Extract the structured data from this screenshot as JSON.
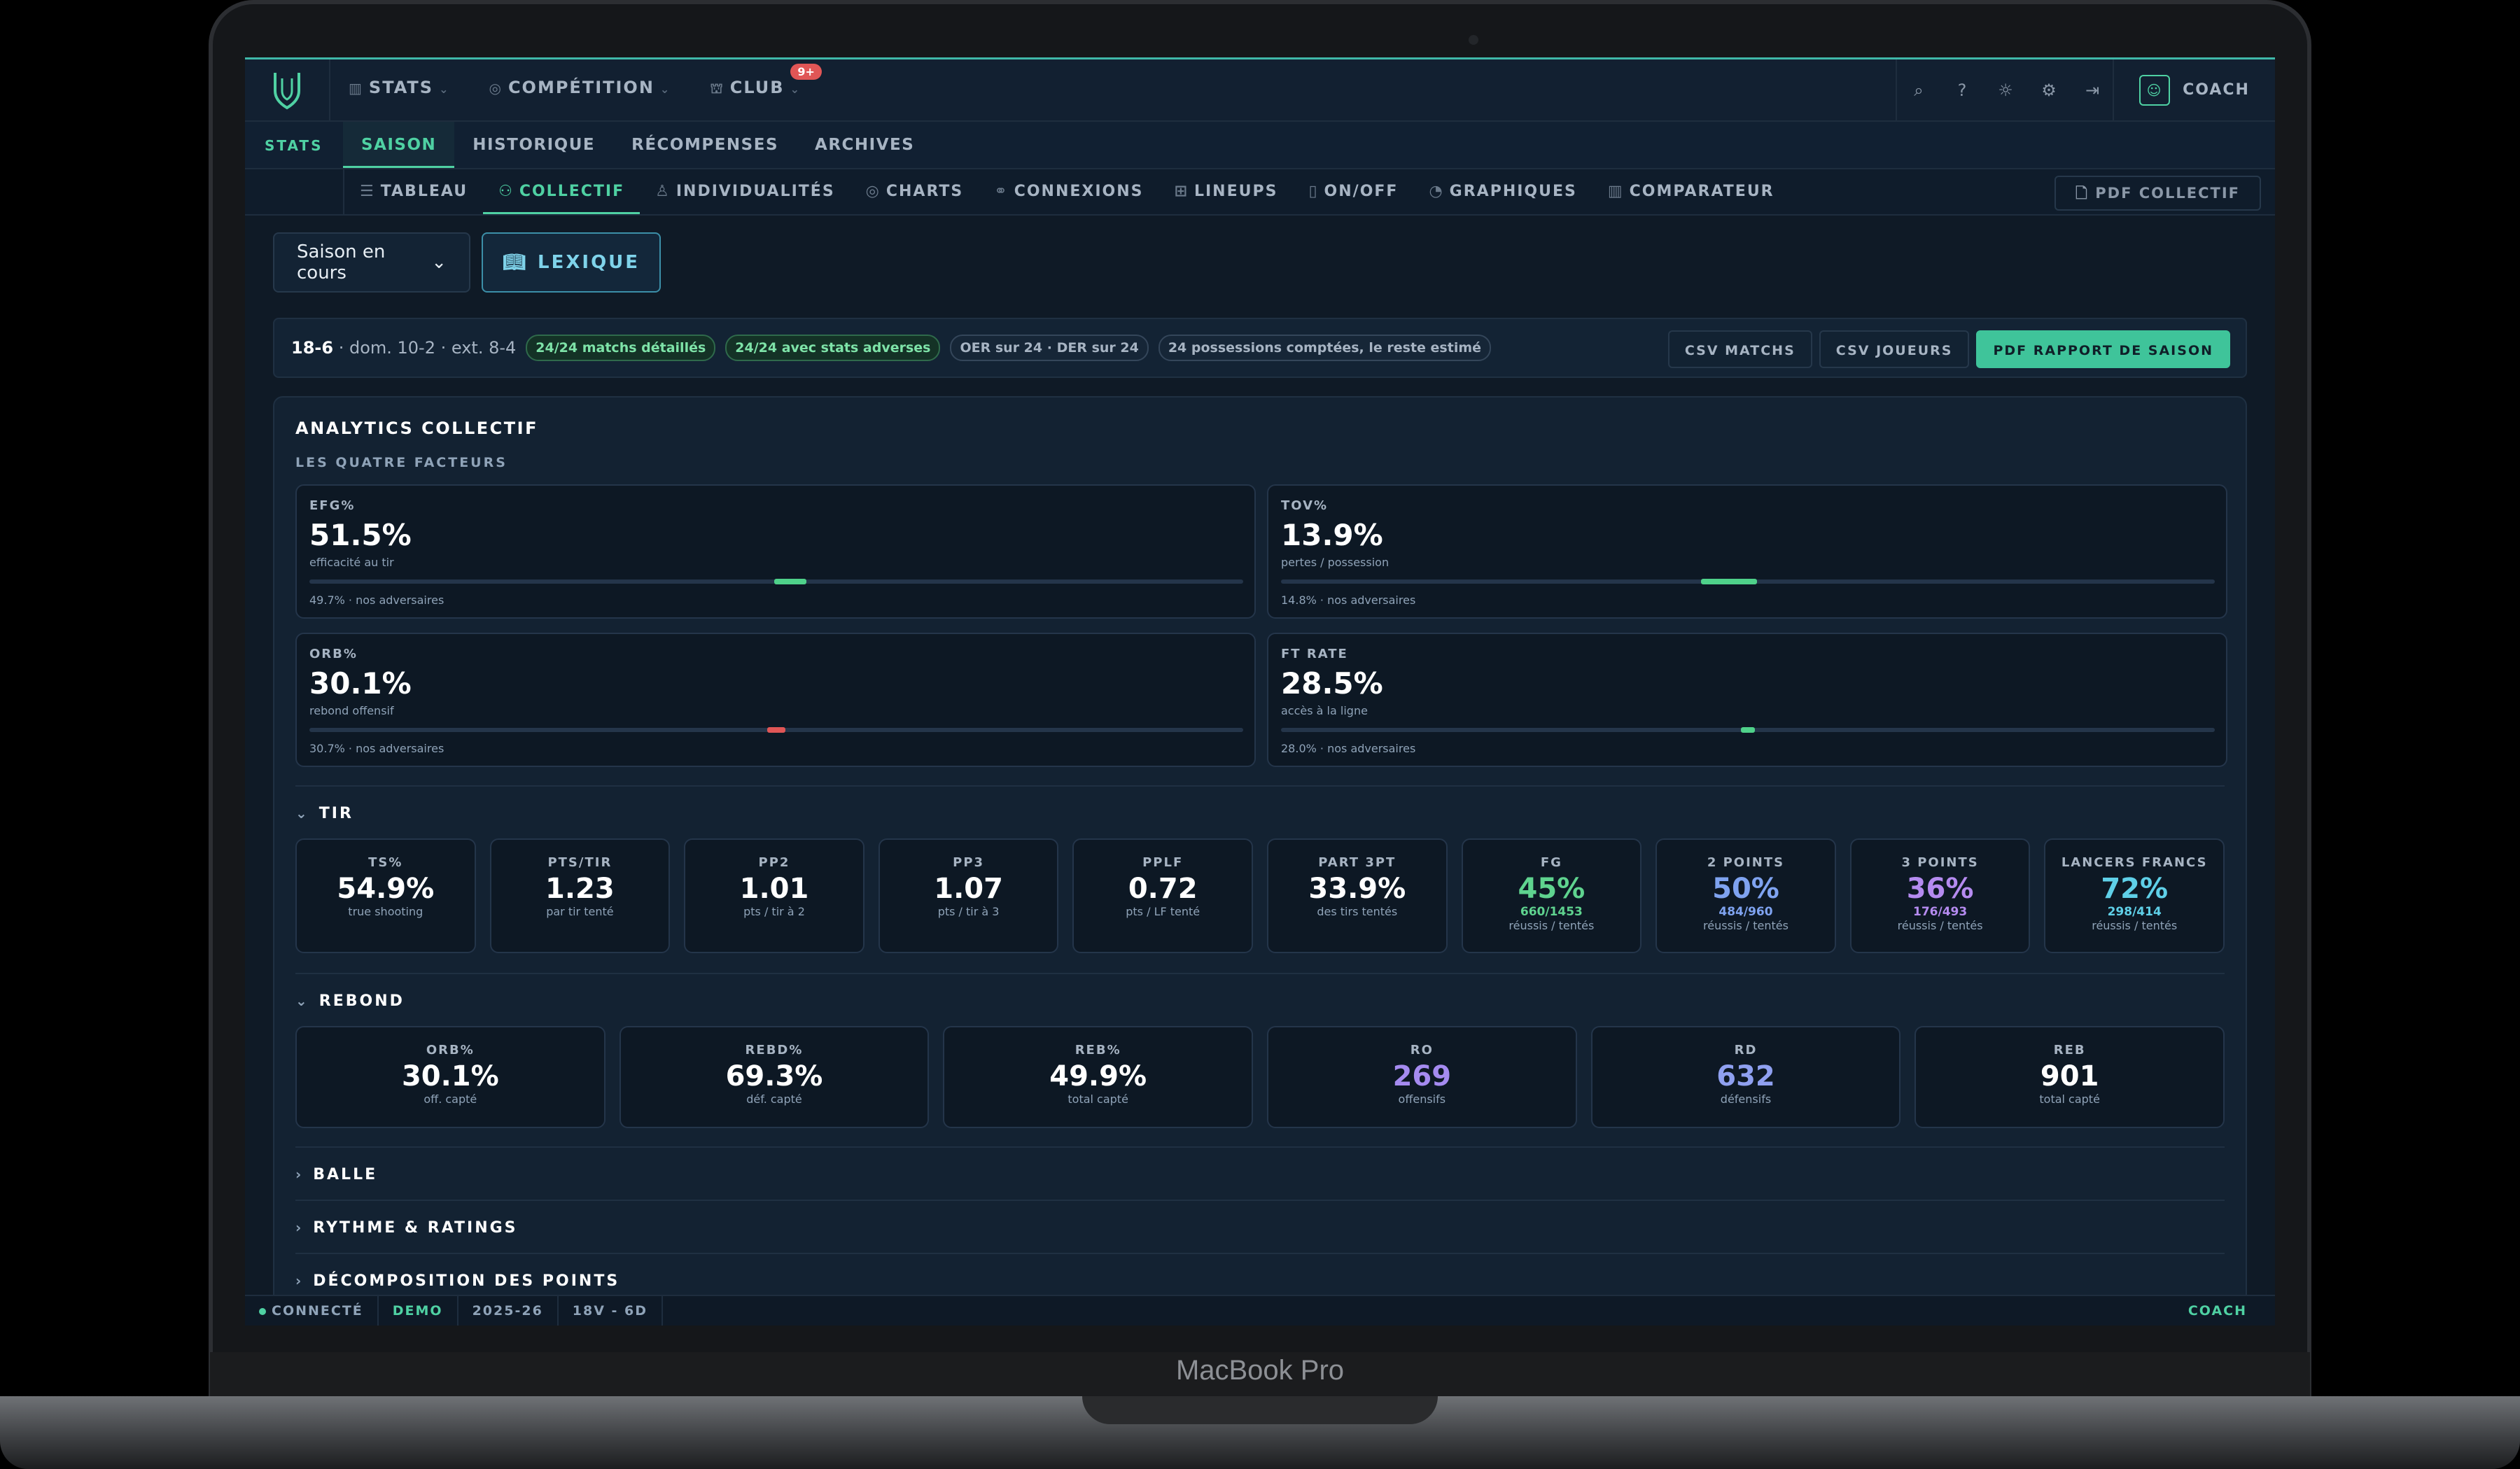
{
  "device": {
    "brand": "MacBook Pro"
  },
  "topnav": {
    "items": [
      {
        "label": "STATS",
        "icon": "bar-chart-icon"
      },
      {
        "label": "COMPÉTITION",
        "icon": "target-icon"
      },
      {
        "label": "CLUB",
        "icon": "users-icon",
        "badge": "9+"
      }
    ],
    "user_label": "COACH"
  },
  "subnav": {
    "section_label": "STATS",
    "tabs": [
      "SAISON",
      "HISTORIQUE",
      "RÉCOMPENSES",
      "ARCHIVES"
    ],
    "active": "SAISON"
  },
  "subnav2": {
    "tabs": [
      "TABLEAU",
      "COLLECTIF",
      "INDIVIDUALITÉS",
      "CHARTS",
      "CONNEXIONS",
      "LINEUPS",
      "ON/OFF",
      "GRAPHIQUES",
      "COMPARATEUR"
    ],
    "active": "COLLECTIF",
    "pdf_label": "PDF COLLECTIF"
  },
  "controls": {
    "season_select": "Saison en cours",
    "lexique_label": "LEXIQUE"
  },
  "summary": {
    "record": "18-6",
    "details": "· dom. 10-2 · ext. 8-4",
    "pills": [
      {
        "text": "24/24 matchs détaillés",
        "tone": "green"
      },
      {
        "text": "24/24 avec stats adverses",
        "tone": "green"
      },
      {
        "text": "OER sur 24 · DER sur 24",
        "tone": "gray"
      },
      {
        "text": "24 possessions comptées, le reste estimé",
        "tone": "gray"
      }
    ],
    "buttons": [
      "CSV MATCHS",
      "CSV JOUEURS",
      "PDF RAPPORT DE SAISON"
    ]
  },
  "analytics": {
    "title": "ANALYTICS COLLECTIF",
    "four_factors_title": "LES QUATRE FACTEURS",
    "factors": [
      {
        "label": "EFG%",
        "value": "51.5%",
        "desc": "efficacité au tir",
        "opp": "49.7% · nos adversaires",
        "level": 0.515,
        "color": "#4fd18a"
      },
      {
        "label": "TOV%",
        "value": "13.9%",
        "desc": "pertes / possession",
        "opp": "14.8% · nos adversaires",
        "level": 0.48,
        "color": "#4fd18a"
      },
      {
        "label": "ORB%",
        "value": "30.1%",
        "desc": "rebond offensif",
        "opp": "30.7% · nos adversaires",
        "level": 0.5,
        "color": "#e05656"
      },
      {
        "label": "FT RATE",
        "value": "28.5%",
        "desc": "accès à la ligne",
        "opp": "28.0% · nos adversaires",
        "level": 0.5,
        "color": "#4fd18a"
      }
    ],
    "tir": {
      "title": "TIR",
      "stats": [
        {
          "label": "TS%",
          "value": "54.9%",
          "sub": "true shooting"
        },
        {
          "label": "PTS/TIR",
          "value": "1.23",
          "sub": "par tir tenté"
        },
        {
          "label": "PP2",
          "value": "1.01",
          "sub": "pts / tir à 2"
        },
        {
          "label": "PP3",
          "value": "1.07",
          "sub": "pts / tir à 3"
        },
        {
          "label": "PPLF",
          "value": "0.72",
          "sub": "pts / LF tenté"
        },
        {
          "label": "PART 3PT",
          "value": "33.9%",
          "sub": "des tirs tentés"
        },
        {
          "label": "FG",
          "value": "45%",
          "frac": "660/1453",
          "sub": "réussis / tentés",
          "color": "#5fd38f"
        },
        {
          "label": "2 POINTS",
          "value": "50%",
          "frac": "484/960",
          "sub": "réussis / tentés",
          "color": "#7fa3f0"
        },
        {
          "label": "3 POINTS",
          "value": "36%",
          "frac": "176/493",
          "sub": "réussis / tentés",
          "color": "#b58bf0"
        },
        {
          "label": "LANCERS FRANCS",
          "value": "72%",
          "frac": "298/414",
          "sub": "réussis / tentés",
          "color": "#5fd0e8"
        }
      ]
    },
    "rebond": {
      "title": "REBOND",
      "stats": [
        {
          "label": "ORB%",
          "value": "30.1%",
          "sub": "off. capté"
        },
        {
          "label": "REBD%",
          "value": "69.3%",
          "sub": "déf. capté"
        },
        {
          "label": "REB%",
          "value": "49.9%",
          "sub": "total capté"
        },
        {
          "label": "RO",
          "value": "269",
          "sub": "offensifs",
          "color": "#a58bf0"
        },
        {
          "label": "RD",
          "value": "632",
          "sub": "défensifs",
          "color": "#8fa0f0"
        },
        {
          "label": "REB",
          "value": "901",
          "sub": "total capté"
        }
      ]
    },
    "collapsed_sections": [
      "BALLE",
      "RYTHME & RATINGS",
      "DÉCOMPOSITION DES POINTS"
    ]
  },
  "statusbar": {
    "status": "CONNECTÉ",
    "mode": "DEMO",
    "season": "2025-26",
    "record": "18V - 6D",
    "user": "COACH"
  },
  "colors": {
    "accent": "#4fd1a3",
    "background": "#0f1a26",
    "danger": "#e05656"
  }
}
